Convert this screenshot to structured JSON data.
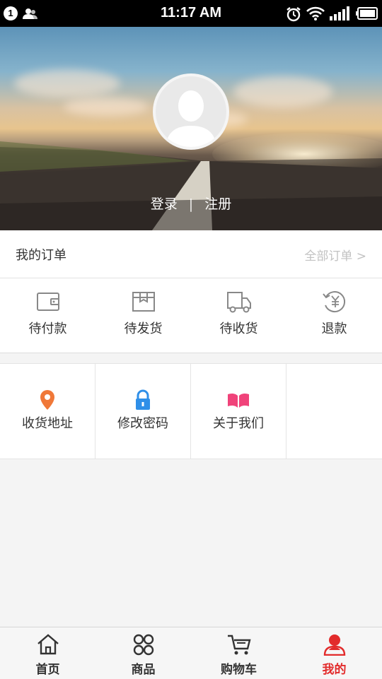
{
  "status_bar": {
    "time": "11:17 AM",
    "notification_count": "1",
    "icons": [
      "contacts-icon",
      "alarm-icon",
      "wifi-icon",
      "signal-icon",
      "battery-icon"
    ]
  },
  "profile": {
    "login_label": "登录",
    "separator": "|",
    "register_label": "注册"
  },
  "orders": {
    "title": "我的订单",
    "all_label": "全部订单 >",
    "items": [
      {
        "label": "待付款",
        "icon": "wallet-icon"
      },
      {
        "label": "待发货",
        "icon": "package-icon"
      },
      {
        "label": "待收货",
        "icon": "truck-icon"
      },
      {
        "label": "退款",
        "icon": "refund-icon"
      }
    ]
  },
  "services": [
    {
      "label": "收货地址",
      "icon": "location-pin-icon",
      "color": "#f07838"
    },
    {
      "label": "修改密码",
      "icon": "lock-icon",
      "color": "#2f8fe8"
    },
    {
      "label": "关于我们",
      "icon": "book-icon",
      "color": "#f0437a"
    }
  ],
  "tabbar": {
    "items": [
      {
        "label": "首页",
        "icon": "home-icon",
        "active": false
      },
      {
        "label": "商品",
        "icon": "grid-icon",
        "active": false
      },
      {
        "label": "购物车",
        "icon": "cart-icon",
        "active": false
      },
      {
        "label": "我的",
        "icon": "user-icon",
        "active": true
      }
    ],
    "active_color": "#e22b2b"
  }
}
